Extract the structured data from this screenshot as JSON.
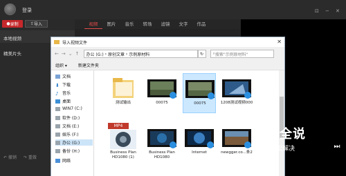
{
  "app": {
    "login_label": "登录",
    "window_controls": [
      "⊡",
      "−",
      "✕"
    ],
    "record_label": "录制",
    "import_label": "导入",
    "side_tabs": [
      "本地视频",
      "精美片头"
    ],
    "bottom_actions": [
      "撤销",
      "重做"
    ],
    "tabs": [
      "视频",
      "图片",
      "音乐",
      "转场",
      "滤镜",
      "文字",
      "作品"
    ],
    "active_tab": "视频",
    "accent": "#e14b4b"
  },
  "dialog": {
    "title": "导入视频文件",
    "path": [
      "办公 (G:)",
      "原创文章",
      "示例原材料"
    ],
    "search_placeholder": "搜索\"示例原材料\"",
    "organize_label": "组织 ▾",
    "new_folder_label": "新建文件夹",
    "nav_items": [
      {
        "label": "文档",
        "icon": "documents-icon"
      },
      {
        "label": "下载",
        "icon": "download-icon"
      },
      {
        "label": "音乐",
        "icon": "music-icon"
      },
      {
        "label": "桌面",
        "icon": "desktop-icon"
      },
      {
        "label": "WIN7 (C:)",
        "icon": "drive-icon"
      },
      {
        "label": "软件 (D:)",
        "icon": "drive-icon"
      },
      {
        "label": "文档 (E:)",
        "icon": "drive-icon"
      },
      {
        "label": "娱乐 (F:)",
        "icon": "drive-icon"
      },
      {
        "label": "办公 (G:)",
        "icon": "drive-icon"
      },
      {
        "label": "备份 (H:)",
        "icon": "drive-icon"
      },
      {
        "label": "网络",
        "icon": "network-icon"
      }
    ],
    "selected_nav": "办公 (G:)",
    "files": [
      {
        "label": "测试输出",
        "kind": "folder"
      },
      {
        "label": "00075",
        "kind": "video"
      },
      {
        "label": "00075",
        "kind": "video",
        "selected": true
      },
      {
        "label": "1208测试视频000",
        "kind": "video"
      },
      {
        "label": "Business Plan HD1080 (1)",
        "kind": "mp4"
      },
      {
        "label": "Business Plan HD1080",
        "kind": "video"
      },
      {
        "label": "Internet",
        "kind": "video"
      },
      {
        "label": "newgger.co...条2",
        "kind": "video"
      }
    ],
    "mp4_badge": "MP4"
  },
  "watermark": {
    "title": "百科全说",
    "subtitle": "助你轻松解决"
  }
}
